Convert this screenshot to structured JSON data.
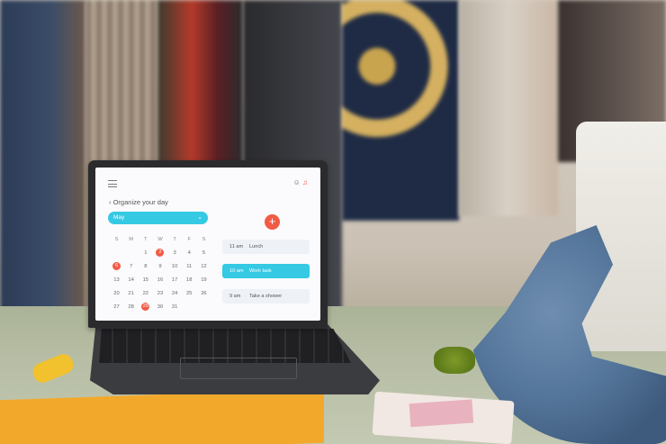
{
  "app": {
    "title": "Organize your day",
    "month": "May",
    "add_label": "+"
  },
  "calendar": {
    "weekdays": [
      "S",
      "M",
      "T",
      "W",
      "T",
      "F",
      "S"
    ],
    "rows": [
      [
        "",
        "",
        "",
        "",
        "",
        "",
        ""
      ],
      [
        "",
        "",
        "1",
        "2",
        "3",
        "4",
        "5"
      ],
      [
        "6",
        "7",
        "8",
        "9",
        "10",
        "11",
        "12"
      ],
      [
        "13",
        "14",
        "15",
        "16",
        "17",
        "18",
        "19"
      ],
      [
        "20",
        "21",
        "22",
        "23",
        "24",
        "25",
        "26"
      ],
      [
        "27",
        "28",
        "29",
        "30",
        "31",
        "",
        ""
      ]
    ],
    "highlighted": [
      "2",
      "6",
      "29"
    ]
  },
  "events": [
    {
      "time": "11 am",
      "label": "Lunch",
      "active": false
    },
    {
      "time": "10 am",
      "label": "Work task",
      "active": true
    },
    {
      "time": "9 am",
      "label": "Take a shower",
      "active": false
    }
  ],
  "colors": {
    "accent": "#35c9e3",
    "highlight": "#f15a45"
  }
}
